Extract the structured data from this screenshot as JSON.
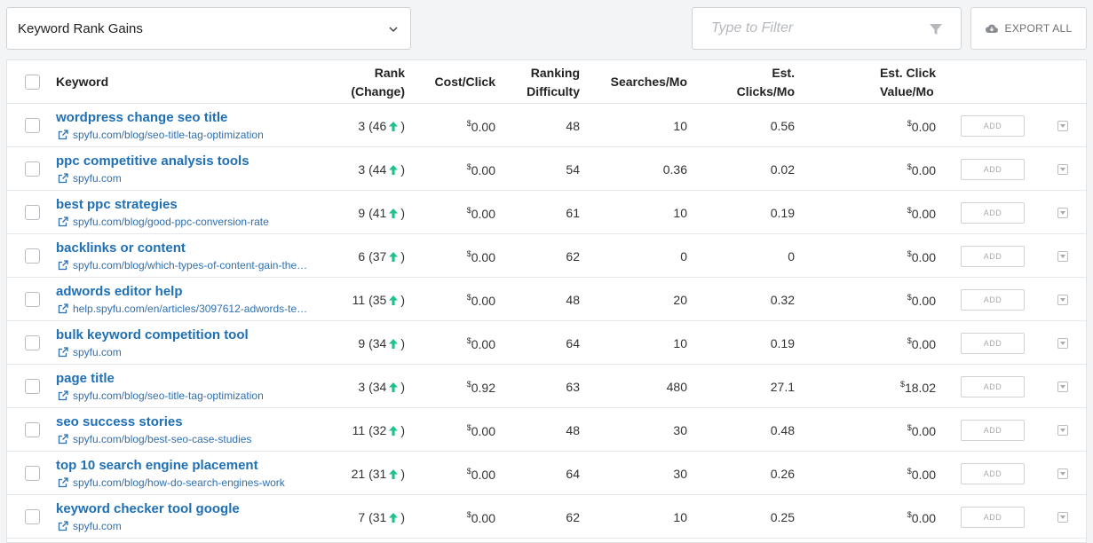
{
  "toolbar": {
    "report_select": "Keyword Rank Gains",
    "filter_placeholder": "Type to Filter",
    "export_label": "EXPORT ALL"
  },
  "table": {
    "headers": {
      "keyword": "Keyword",
      "rank_1": "Rank",
      "rank_2": "(Change)",
      "cost_click": "Cost/Click",
      "difficulty_1": "Ranking",
      "difficulty_2": "Difficulty",
      "searches": "Searches/Mo",
      "clicks_1": "Est.",
      "clicks_2": "Clicks/Mo",
      "value_1": "Est. Click",
      "value_2": "Value/Mo"
    },
    "add_label": "ADD",
    "currency_symbol": "$",
    "rows": [
      {
        "keyword": "wordpress change seo title",
        "url": "spyfu.com/blog/seo-title-tag-optimization",
        "rank": "3",
        "change": "46",
        "cost": "0.00",
        "difficulty": "48",
        "searches": "10",
        "clicks": "0.56",
        "value": "0.00"
      },
      {
        "keyword": "ppc competitive analysis tools",
        "url": "spyfu.com",
        "rank": "3",
        "change": "44",
        "cost": "0.00",
        "difficulty": "54",
        "searches": "0.36",
        "clicks": "0.02",
        "value": "0.00"
      },
      {
        "keyword": "best ppc strategies",
        "url": "spyfu.com/blog/good-ppc-conversion-rate",
        "rank": "9",
        "change": "41",
        "cost": "0.00",
        "difficulty": "61",
        "searches": "10",
        "clicks": "0.19",
        "value": "0.00"
      },
      {
        "keyword": "backlinks or content",
        "url": "spyfu.com/blog/which-types-of-content-gain-the…",
        "rank": "6",
        "change": "37",
        "cost": "0.00",
        "difficulty": "62",
        "searches": "0",
        "clicks": "0",
        "value": "0.00"
      },
      {
        "keyword": "adwords editor help",
        "url": "help.spyfu.com/en/articles/3097612-adwords-te…",
        "rank": "11",
        "change": "35",
        "cost": "0.00",
        "difficulty": "48",
        "searches": "20",
        "clicks": "0.32",
        "value": "0.00"
      },
      {
        "keyword": "bulk keyword competition tool",
        "url": "spyfu.com",
        "rank": "9",
        "change": "34",
        "cost": "0.00",
        "difficulty": "64",
        "searches": "10",
        "clicks": "0.19",
        "value": "0.00"
      },
      {
        "keyword": "page title",
        "url": "spyfu.com/blog/seo-title-tag-optimization",
        "rank": "3",
        "change": "34",
        "cost": "0.92",
        "difficulty": "63",
        "searches": "480",
        "clicks": "27.1",
        "value": "18.02"
      },
      {
        "keyword": "seo success stories",
        "url": "spyfu.com/blog/best-seo-case-studies",
        "rank": "11",
        "change": "32",
        "cost": "0.00",
        "difficulty": "48",
        "searches": "30",
        "clicks": "0.48",
        "value": "0.00"
      },
      {
        "keyword": "top 10 search engine placement",
        "url": "spyfu.com/blog/how-do-search-engines-work",
        "rank": "21",
        "change": "31",
        "cost": "0.00",
        "difficulty": "64",
        "searches": "30",
        "clicks": "0.26",
        "value": "0.00"
      },
      {
        "keyword": "keyword checker tool google",
        "url": "spyfu.com",
        "rank": "7",
        "change": "31",
        "cost": "0.00",
        "difficulty": "62",
        "searches": "10",
        "clicks": "0.25",
        "value": "0.00"
      }
    ]
  },
  "colors": {
    "link": "#1f6fb5",
    "up_arrow": "#1fc28a"
  }
}
